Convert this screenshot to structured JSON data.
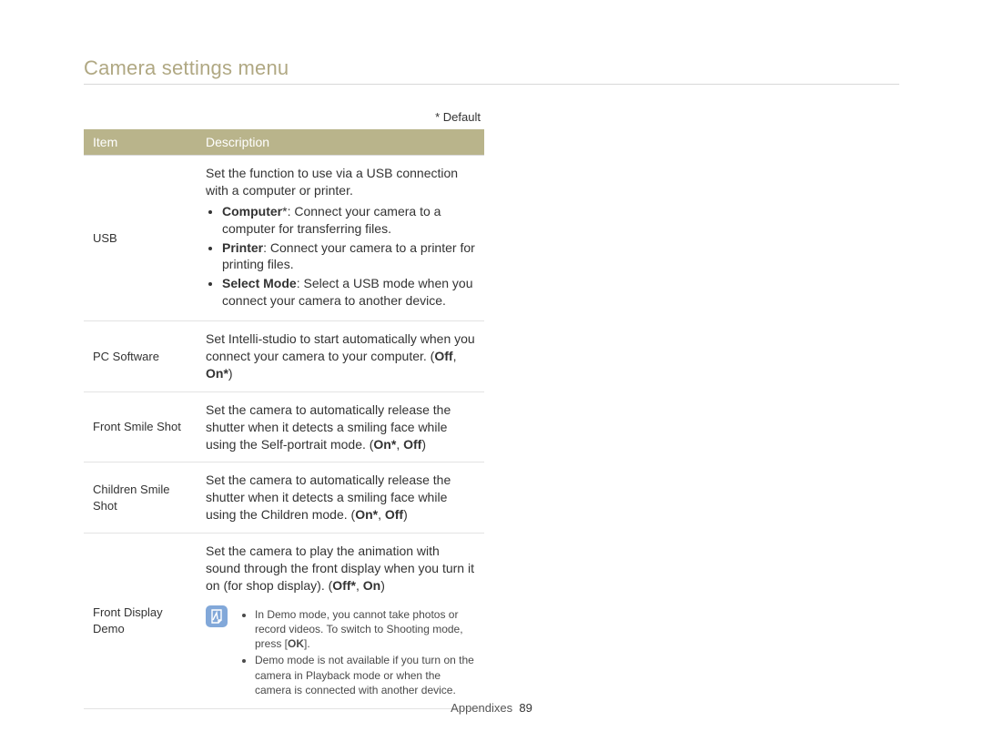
{
  "header": {
    "title": "Camera settings menu"
  },
  "default_note": "* Default",
  "table": {
    "head": {
      "item": "Item",
      "description": "Description"
    },
    "rows": {
      "usb": {
        "item": "USB",
        "intro": "Set the function to use via a USB connection with a computer or printer.",
        "b1_label": "Computer",
        "b1_star": "*",
        "b1_text": ": Connect your camera to a computer for transferring files.",
        "b2_label": "Printer",
        "b2_text": ": Connect your camera to a printer for printing files.",
        "b3_label": "Select Mode",
        "b3_text": ": Select a USB mode when you connect your camera to another device."
      },
      "pcsoft": {
        "item": "PC Software",
        "text_a": "Set Intelli-studio to start automatically when you connect your camera to your computer. (",
        "off": "Off",
        "sep": ", ",
        "on": "On*",
        "close": ")"
      },
      "frontsmile": {
        "item": "Front Smile Shot",
        "text_a": "Set the camera to automatically release the shutter when it detects a smiling face while using the Self-portrait mode. (",
        "on": "On*",
        "sep": ", ",
        "off": "Off",
        "close": ")"
      },
      "childsmile": {
        "item": "Children Smile Shot",
        "text_a": "Set the camera to automatically release the shutter when it detects a smiling face while using the Children mode. (",
        "on": "On*",
        "sep": ", ",
        "off": "Off",
        "close": ")"
      },
      "frontdemo": {
        "item": "Front Display Demo",
        "text_a": "Set the camera to play the animation with sound through the front display when you turn it on (for shop display). (",
        "off": "Off*",
        "sep": ", ",
        "on": "On",
        "close": ")",
        "note1_a": "In Demo mode, you cannot take photos or record videos. To switch to Shooting mode, press [",
        "note1_ok": "OK",
        "note1_b": "].",
        "note2": "Demo mode is not available if you turn on the camera in Playback mode or when the camera is connected with another device."
      }
    }
  },
  "footer": {
    "section": "Appendixes",
    "page": "89"
  }
}
